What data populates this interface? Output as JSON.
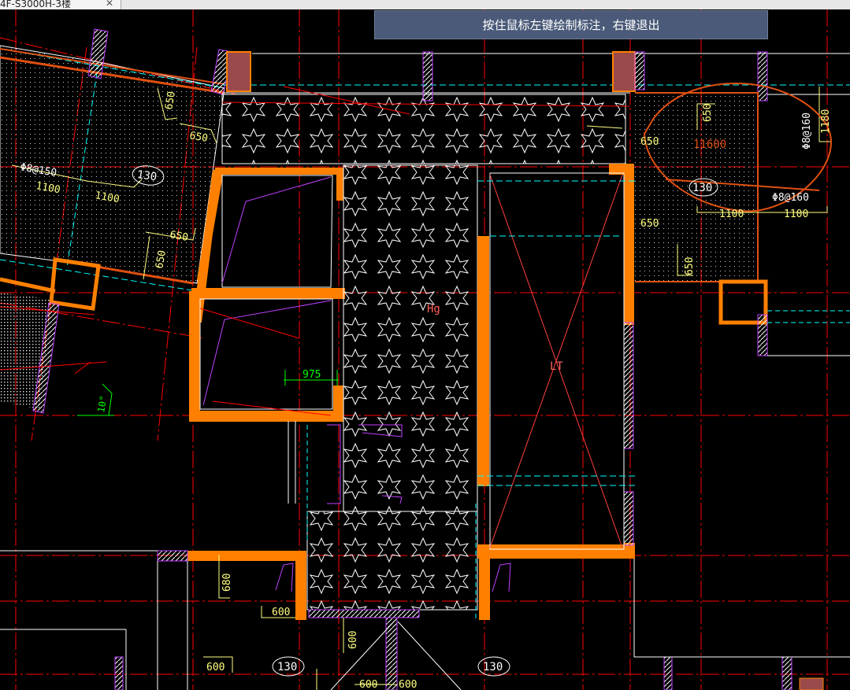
{
  "window": {
    "tab_title": "4F-S3000H-3楼",
    "close_glyph": "✕"
  },
  "command_prompt": "按住鼠标左键绘制标注，右键退出",
  "drawing": {
    "dimensions": {
      "d650_a": "650",
      "d650_b": "650",
      "d650_c": "650",
      "d650_d": "650",
      "d650_e": "650",
      "d650_f": "650",
      "d650_g": "650",
      "d1100_a": "1100",
      "d1100_b": "1100",
      "d1100_c": "1100",
      "d1100_d": "1100",
      "d975": "975",
      "d680": "680",
      "d600_a": "600",
      "d600_b": "600",
      "d600_c": "600",
      "d600_d": "600",
      "d600_e": "600",
      "d1180": "1180",
      "d11600": "11600"
    },
    "rebar": {
      "left": "Φ8@150",
      "right_vertical": "Φ8@160",
      "right_horizontal": "Φ8@160"
    },
    "slab_thickness": {
      "left": "130",
      "right": "130",
      "bottom_left": "130",
      "bottom_right": "130"
    },
    "labels": {
      "elevator": "LT",
      "hatch": "Hg",
      "angle": "10°"
    },
    "colors": {
      "background": "#000000",
      "wall": "#ff8000",
      "axis": "#ff0000",
      "dimension": "#ffff80",
      "dashed_cyan": "#00ffff",
      "purple": "#c040ff",
      "markup": "#e05010"
    }
  }
}
